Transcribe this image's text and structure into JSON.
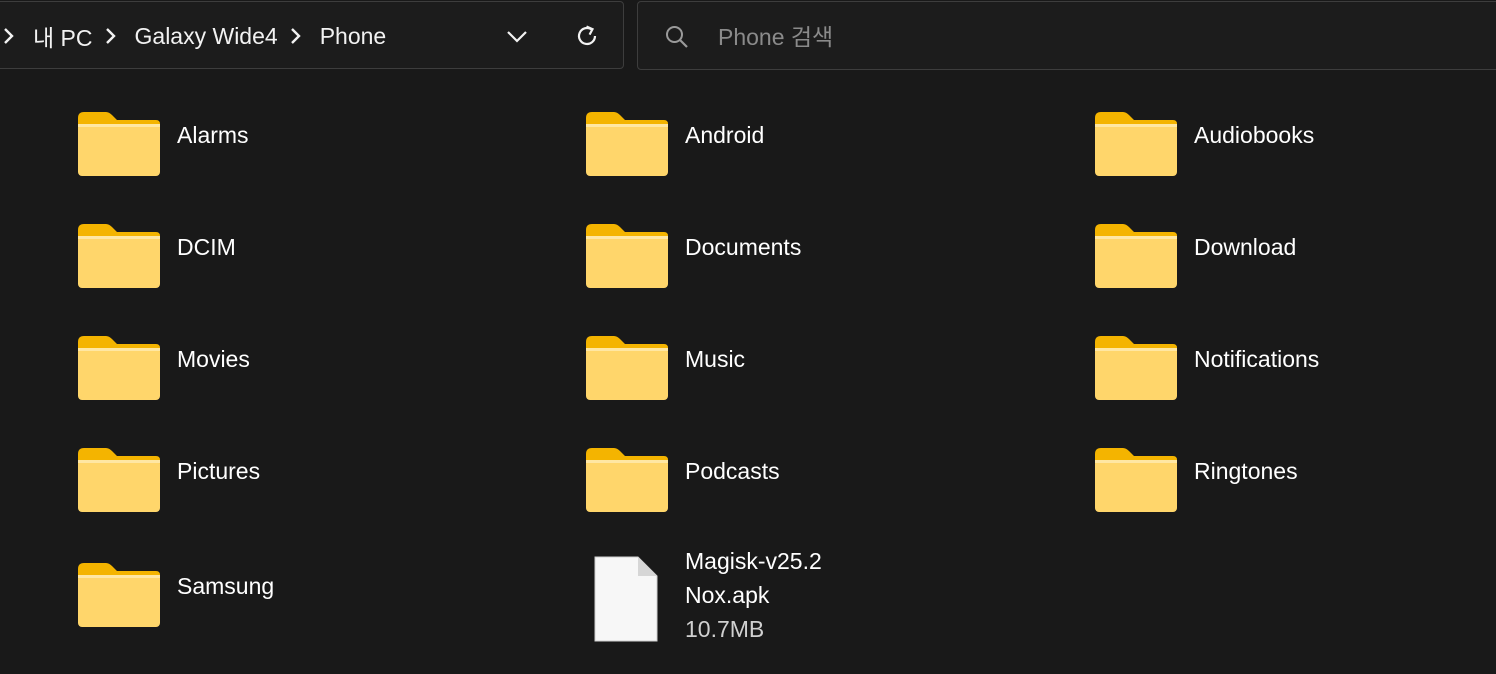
{
  "breadcrumb": {
    "items": [
      "내 PC",
      "Galaxy Wide4",
      "Phone"
    ]
  },
  "search": {
    "placeholder": "Phone 검색"
  },
  "items": [
    {
      "name": "Alarms",
      "type": "folder"
    },
    {
      "name": "Android",
      "type": "folder"
    },
    {
      "name": "Audiobooks",
      "type": "folder"
    },
    {
      "name": "DCIM",
      "type": "folder"
    },
    {
      "name": "Documents",
      "type": "folder"
    },
    {
      "name": "Download",
      "type": "folder"
    },
    {
      "name": "Movies",
      "type": "folder"
    },
    {
      "name": "Music",
      "type": "folder"
    },
    {
      "name": "Notifications",
      "type": "folder"
    },
    {
      "name": "Pictures",
      "type": "folder"
    },
    {
      "name": "Podcasts",
      "type": "folder"
    },
    {
      "name": "Ringtones",
      "type": "folder"
    },
    {
      "name": "Samsung",
      "type": "folder"
    }
  ],
  "file": {
    "name_line1": "Magisk-v25.2",
    "name_line2": "Nox.apk",
    "size": "10.7MB"
  },
  "icons": {
    "separator": "chevron-right-icon",
    "dropdown": "chevron-down-icon",
    "refresh": "refresh-icon",
    "search": "search-icon",
    "folder": "folder-icon",
    "file": "file-icon"
  },
  "colors": {
    "background": "#191919",
    "border": "#3d3d3d",
    "folder_body": "#ffd66b",
    "folder_tab": "#f4b400",
    "text": "#ffffff",
    "placeholder": "#8a8a8a"
  }
}
